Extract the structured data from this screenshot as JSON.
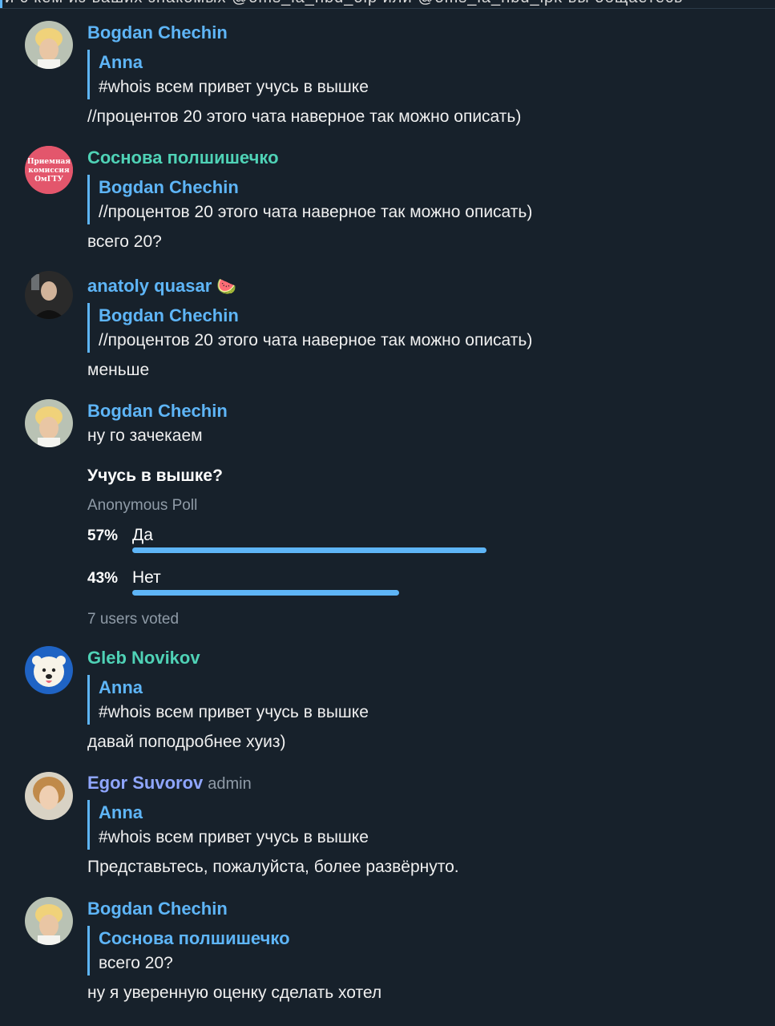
{
  "top_strip_text": "и с кем из ваших знакомых @oms_ia_nbd_oip или @oms_ia_nbd_ipk вы общаетесь",
  "messages": [
    {
      "sender": "Bogdan Chechin",
      "reply_name": "Anna",
      "reply_text": "#whois   всем привет учусь в вышке",
      "text": "//процентов 20 этого чата наверное так можно описать)"
    },
    {
      "sender": "Соснова полшишечко",
      "reply_name": "Bogdan Chechin",
      "reply_text": "//процентов 20 этого чата наверное так можно описать)",
      "text": "всего 20?"
    },
    {
      "sender": "anatoly quasar",
      "sender_emoji": "🍉",
      "reply_name": "Bogdan Chechin",
      "reply_text": "//процентов 20 этого чата наверное так можно описать)",
      "text": "меньше"
    },
    {
      "sender": "Bogdan Chechin",
      "text": "ну го зачекаем"
    },
    {
      "sender": "Gleb Novikov",
      "reply_name": "Anna",
      "reply_text": "#whois   всем привет учусь в вышке",
      "text": "давай поподробнее хуиз)"
    },
    {
      "sender": "Egor Suvorov",
      "badge": "admin",
      "reply_name": "Anna",
      "reply_text": "#whois   всем привет учусь в вышке",
      "text": "Представьтесь, пожалуйста, более развёрнуто."
    },
    {
      "sender": "Bogdan Chechin",
      "reply_name": "Соснова полшишечко",
      "reply_text": "всего 20?",
      "text": "ну я уверенную оценку сделать хотел"
    }
  ],
  "avatar_texts": {
    "priemnaya": [
      "Приемная",
      "комиссия",
      "ОмГТУ"
    ]
  },
  "poll": {
    "question": "Учусь в вышке?",
    "type": "Anonymous Poll",
    "options": [
      {
        "percent": "57%",
        "label": "Да",
        "fraction": 0.57
      },
      {
        "percent": "43%",
        "label": "Нет",
        "fraction": 0.43
      }
    ],
    "voted": "7 users voted"
  },
  "colors": {
    "background": "#17212b",
    "accent": "#5eb5f7",
    "teal": "#4fd2b6",
    "purple": "#8fa6ff"
  }
}
